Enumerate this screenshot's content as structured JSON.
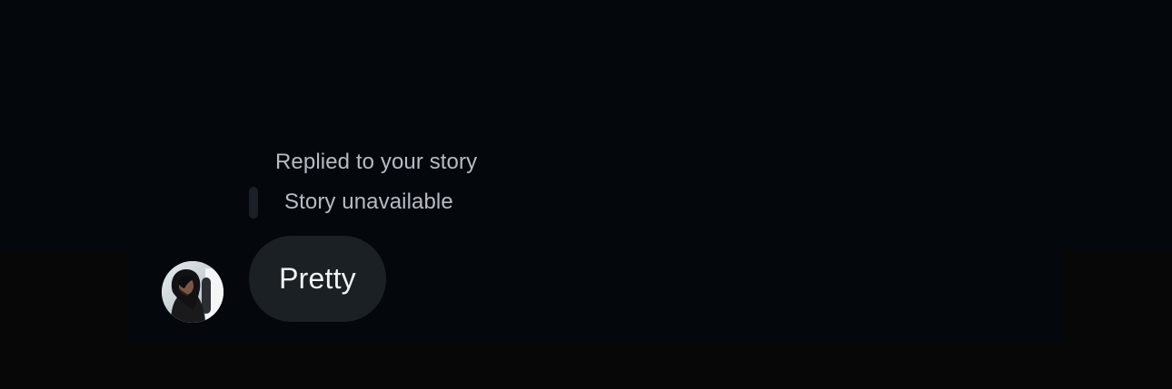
{
  "thread": {
    "reply_caption": "Replied to your story",
    "story_status": "Story unavailable",
    "message": {
      "text": "Pretty"
    },
    "sender": {
      "avatar_icon": "profile-photo"
    }
  },
  "colors": {
    "background": "#04070b",
    "panel": "#04080c",
    "bubble": "#1b2024",
    "caption_text": "#b6bcc4",
    "message_text": "#f1f3f5"
  }
}
